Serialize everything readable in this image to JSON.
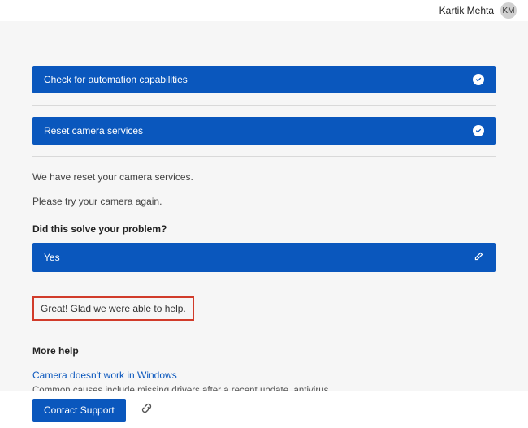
{
  "header": {
    "user_name": "Kartik Mehta",
    "user_initials": "KM"
  },
  "panels": {
    "automation": {
      "title": "Check for automation capabilities"
    },
    "reset": {
      "title": "Reset camera services"
    }
  },
  "status": {
    "reset_done": "We have reset your camera services.",
    "try_again": "Please try your camera again."
  },
  "feedback": {
    "question": "Did this solve your problem?",
    "answer": "Yes",
    "thanks": "Great! Glad we were able to help."
  },
  "more_help": {
    "heading": "More help",
    "article_title": "Camera doesn't work in Windows",
    "article_desc": "Common causes include missing drivers after a recent update, antivirus software blocking the camera, restrictive privacy settings, or issues with the app you're trying to use. This article..."
  },
  "footer": {
    "contact": "Contact Support"
  }
}
